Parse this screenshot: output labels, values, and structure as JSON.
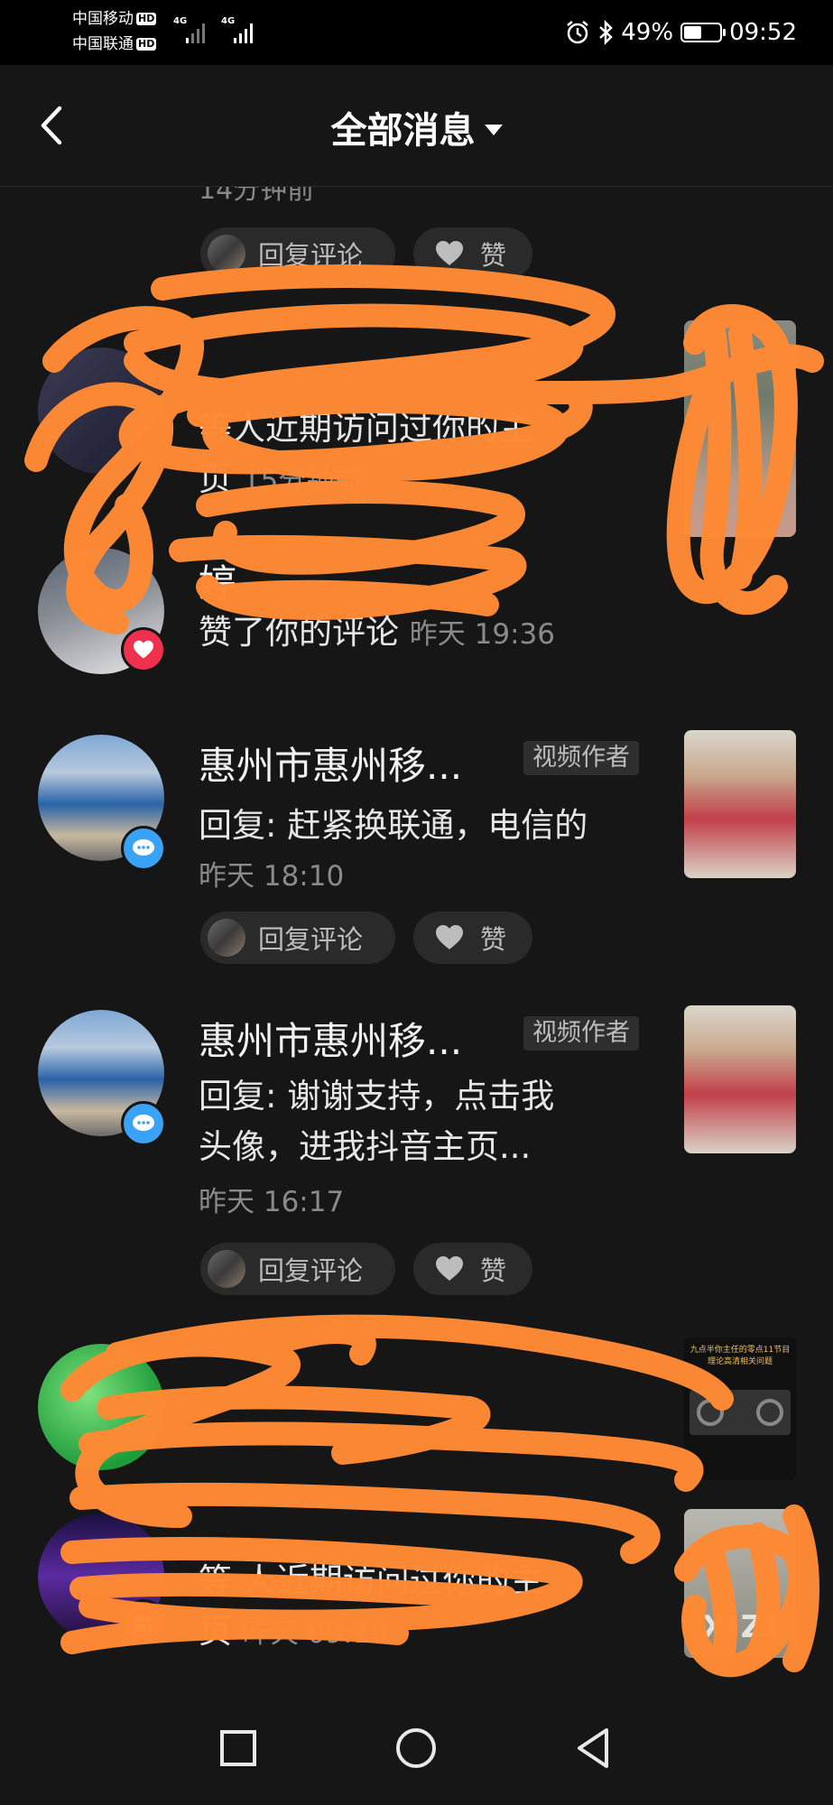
{
  "status_bar": {
    "carrier1": "中国移动",
    "carrier2": "中国联通",
    "hd": "HD",
    "network": "4G",
    "battery": "49%",
    "battery_level": 0.49,
    "time": "09:52"
  },
  "header": {
    "title": "全部消息"
  },
  "list": {
    "top_partial_time": "14分钟前",
    "reply_label": "回复评论",
    "like_label": "赞",
    "items": [
      {
        "text_line1": "等人近期访问过你的主",
        "text_line2": "页",
        "time": "15分钟前"
      },
      {
        "name": "婷",
        "action": "赞了你的评论",
        "time": "昨天 19:36"
      },
      {
        "name": "惠州市惠州移...",
        "tag": "视频作者",
        "reply": "回复: 赶紧换联通，电信的",
        "time": "昨天 18:10"
      },
      {
        "name": "惠州市惠州移...",
        "tag": "视频作者",
        "reply_line1": "回复: 谢谢支持，点击我",
        "reply_line2": "头像，进我抖音主页...",
        "time": "昨天 16:17"
      },
      {
        "thumb_caption": "九点半你主任的零点11节目 理论高清相关问题"
      },
      {
        "text_line1": "等 人近期访问过你的主",
        "text_line2": "页",
        "time": "昨天 09:10",
        "watermark": "XIZI"
      }
    ]
  },
  "colors": {
    "background": "#161616",
    "scribble": "#ff8a34",
    "blue_badge": "#3aa3f7",
    "red_badge": "#f0314e"
  }
}
